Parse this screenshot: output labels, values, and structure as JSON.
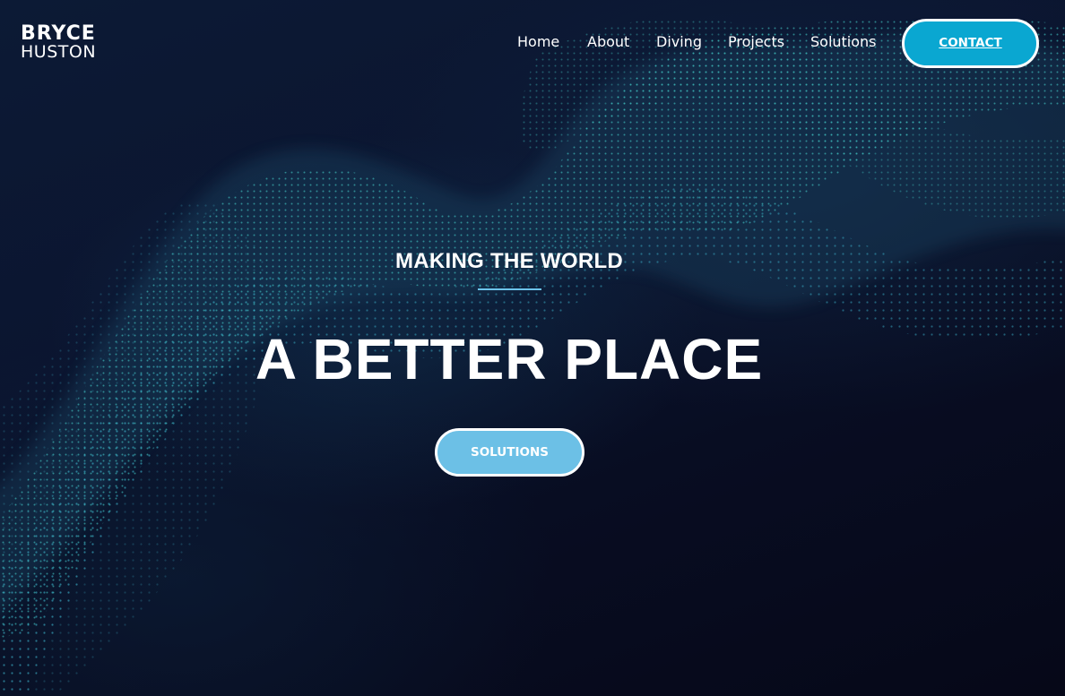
{
  "header": {
    "logo": {
      "line1": "BRYCE",
      "line2": "HUSTON"
    },
    "nav": [
      {
        "label": "Home"
      },
      {
        "label": "About"
      },
      {
        "label": "Diving"
      },
      {
        "label": "Projects"
      },
      {
        "label": "Solutions"
      }
    ],
    "contact_label": "CONTACT"
  },
  "hero": {
    "eyebrow": "MAKING THE WORLD",
    "headline": "A BETTER PLACE",
    "cta_label": "SOLUTIONS"
  },
  "colors": {
    "background": "#0a0f24",
    "particles": "#3fd6d0",
    "contact_button": "#0aa7d1",
    "solutions_button": "#6cc0e6",
    "divider": "#6dc3ea",
    "text": "#ffffff"
  }
}
